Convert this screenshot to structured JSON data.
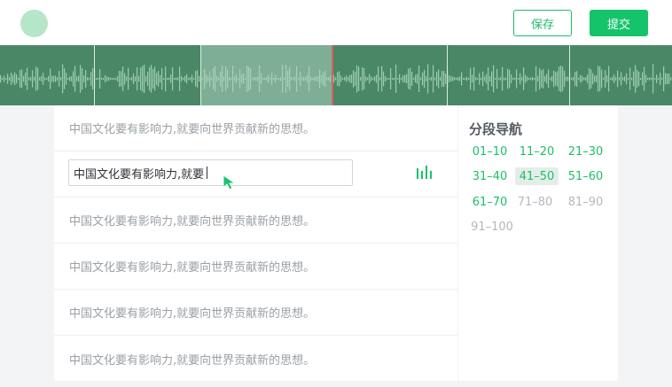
{
  "header": {
    "save_label": "保存",
    "submit_label": "提交"
  },
  "transcript": {
    "rows": [
      {
        "text": "中国文化要有影响力,就要向世界贡献新的思想。",
        "state": "static"
      },
      {
        "text": "中国文化要有影响力,就要",
        "state": "editing"
      },
      {
        "text": "中国文化要有影响力,就要向世界贡献新的思想。",
        "state": "static"
      },
      {
        "text": "中国文化要有影响力,就要向世界贡献新的思想。",
        "state": "static"
      },
      {
        "text": "中国文化要有影响力,就要向世界贡献新的思想。",
        "state": "static"
      },
      {
        "text": "中国文化要有影响力,就要向世界贡献新的思想。",
        "state": "static"
      }
    ]
  },
  "nav": {
    "title": "分段导航",
    "segments": [
      {
        "label": "01–10",
        "state": "done"
      },
      {
        "label": "11–20",
        "state": "done"
      },
      {
        "label": "21–30",
        "state": "done"
      },
      {
        "label": "31–40",
        "state": "done"
      },
      {
        "label": "41–50",
        "state": "current"
      },
      {
        "label": "51–60",
        "state": "done"
      },
      {
        "label": "61–70",
        "state": "done"
      },
      {
        "label": "71–80",
        "state": "todo"
      },
      {
        "label": "81–90",
        "state": "todo"
      },
      {
        "label": "91–100",
        "state": "todo"
      }
    ]
  },
  "colors": {
    "accent": "#15c36a",
    "waveform_bg": "#4a8766",
    "waveform_highlight": "#7fae96",
    "playhead": "#e0605a",
    "muted_text": "#9aa0a6"
  },
  "icons": {
    "audio": "audio-bars-icon",
    "cursor": "mouse-pointer-icon"
  }
}
